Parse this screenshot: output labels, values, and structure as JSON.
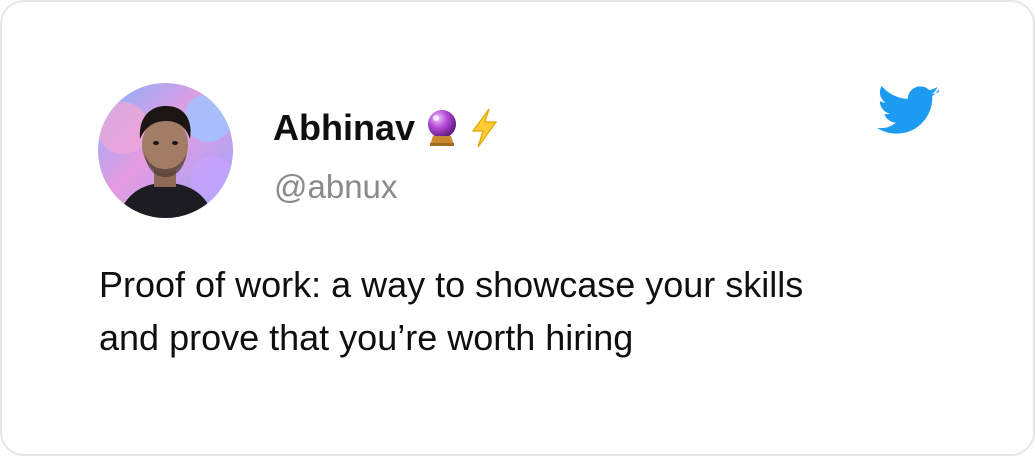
{
  "author": {
    "display_name": "Abhinav",
    "handle": "@abnux",
    "name_emojis": [
      "crystal-ball-icon",
      "lightning-bolt-icon"
    ]
  },
  "tweet": {
    "lines": [
      "Proof of work: a way to showcase your skills",
      "and prove that you’re worth hiring"
    ]
  },
  "colors": {
    "twitter_blue": "#1d9bf0",
    "handle_gray": "#8a8a8a",
    "text": "#0f0f0f",
    "card_border": "#e6e6e6"
  }
}
